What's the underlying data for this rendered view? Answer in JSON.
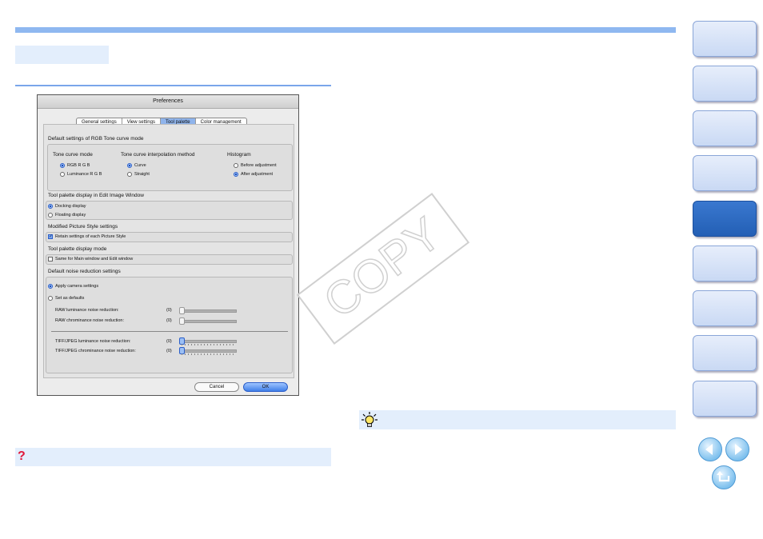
{
  "dialog": {
    "title": "Preferences",
    "tabs": [
      {
        "label": "General settings"
      },
      {
        "label": "View settings"
      },
      {
        "label": "Tool palette"
      },
      {
        "label": "Color management"
      }
    ],
    "sections": {
      "tone_curve": {
        "title": "Default settings of RGB Tone curve mode",
        "mode_label": "Tone curve mode",
        "mode_options": [
          "RGB R G B",
          "Luminance R G B"
        ],
        "interp_label": "Tone curve interpolation method",
        "interp_options": [
          "Curve",
          "Straight"
        ],
        "histogram_label": "Histogram",
        "histogram_options": [
          "Before adjustment",
          "After adjustment"
        ]
      },
      "palette_display": {
        "title": "Tool palette display in Edit Image Window",
        "options": [
          "Docking display",
          "Floating display"
        ]
      },
      "picture_style": {
        "title": "Modified Picture Style settings",
        "checkbox": "Retain settings of each Picture Style"
      },
      "display_mode": {
        "title": "Tool palette display mode",
        "checkbox": "Same for Main window and Edit window"
      },
      "noise": {
        "title": "Default noise reduction settings",
        "options": [
          "Apply camera settings",
          "Set as defaults"
        ],
        "raw_lum": "RAW luminance noise reduction:",
        "raw_chrom": "RAW chrominance noise reduction:",
        "tiff_lum": "TIFF/JPEG luminance noise reduction:",
        "tiff_chrom": "TIFF/JPEG chrominance noise reduction:",
        "value": "(0)"
      }
    },
    "cancel_label": "Cancel",
    "ok_label": "OK"
  },
  "watermark": "COPY",
  "colors": {
    "accent": "#8fb8f0",
    "panel": "#e3eefc",
    "nav_active": "#2f6cc4",
    "question": "#e0193b"
  }
}
